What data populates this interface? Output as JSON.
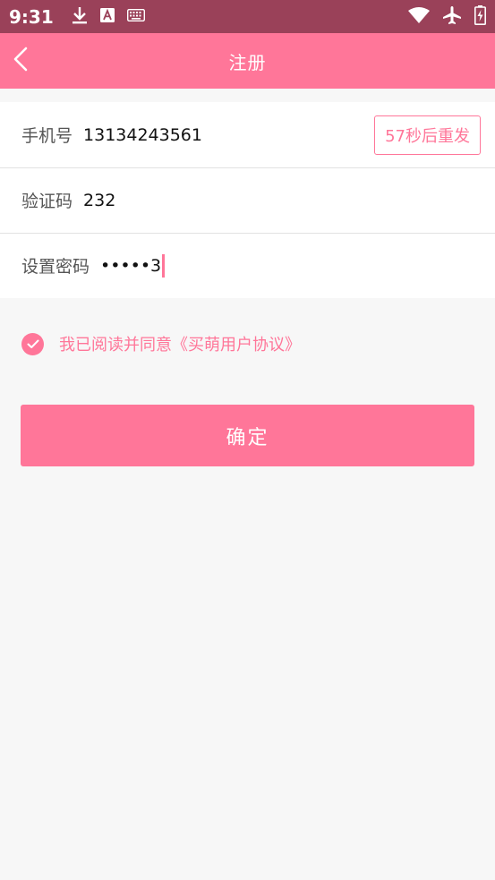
{
  "status_bar": {
    "time": "9:31",
    "left_icons": [
      "download-icon",
      "text-a-icon",
      "keyboard-icon"
    ],
    "right_icons": [
      "wifi-icon",
      "airplane-icon",
      "battery-charging-icon"
    ]
  },
  "app_bar": {
    "title": "注册",
    "back_icon": "chevron-left-icon"
  },
  "form": {
    "phone": {
      "label": "手机号",
      "value": "13134243561"
    },
    "resend_label": "57秒后重发",
    "code": {
      "label": "验证码",
      "value": "232"
    },
    "password": {
      "label": "设置密码",
      "value": "•••••3"
    }
  },
  "agreement": {
    "checked": true,
    "text": "我已阅读并同意《买萌用户协议》"
  },
  "confirm_label": "确定",
  "colors": {
    "status_bar": "#9a4159",
    "accent": "#ff7699",
    "background": "#f7f7f7"
  }
}
